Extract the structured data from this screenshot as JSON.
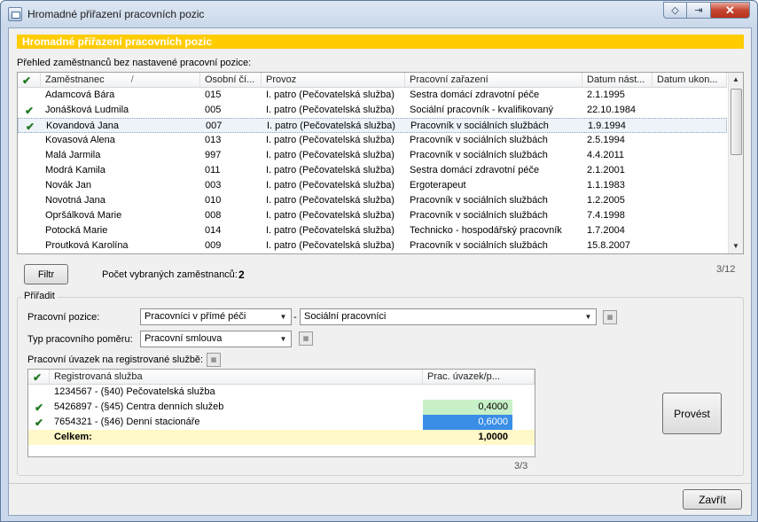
{
  "window": {
    "title": "Hromadné přiřazení pracovních pozic",
    "caption_buttons": [
      "restore-icon",
      "help-icon",
      "close-icon"
    ]
  },
  "header_band": "Hromadné přiřazení pracovních pozic",
  "overview_label": "Přehled zaměstnanců bez nastavené pracovní pozice:",
  "employees_grid": {
    "columns": [
      "",
      "Zaměstnanec",
      "Osobní čí...",
      "Provoz",
      "Pracovní zařazení",
      "Datum nást...",
      "Datum ukon..."
    ],
    "sort_indicator": "/",
    "rows": [
      {
        "checked": false,
        "name": "Adamcová Bára",
        "number": "015",
        "provoz": "I. patro (Pečovatelská služba)",
        "zarazeni": "Sestra domácí zdravotní péče",
        "nastup": "2.1.1995",
        "ukonceni": ""
      },
      {
        "checked": true,
        "name": "Jonášková Ludmila",
        "number": "005",
        "provoz": "I. patro (Pečovatelská služba)",
        "zarazeni": "Sociální pracovník - kvalifikovaný",
        "nastup": "22.10.1984",
        "ukonceni": ""
      },
      {
        "checked": true,
        "name": "Kovandová Jana",
        "number": "007",
        "provoz": "I. patro (Pečovatelská služba)",
        "zarazeni": "Pracovník v sociálních službách",
        "nastup": "1.9.1994",
        "ukonceni": "",
        "selected": true
      },
      {
        "checked": false,
        "name": "Kovasová Alena",
        "number": "013",
        "provoz": "I. patro (Pečovatelská služba)",
        "zarazeni": "Pracovník v sociálních službách",
        "nastup": "2.5.1994",
        "ukonceni": ""
      },
      {
        "checked": false,
        "name": "Malá Jarmila",
        "number": "997",
        "provoz": "I. patro (Pečovatelská služba)",
        "zarazeni": "Pracovník v sociálních službách",
        "nastup": "4.4.2011",
        "ukonceni": ""
      },
      {
        "checked": false,
        "name": "Modrá Kamila",
        "number": "011",
        "provoz": "I. patro (Pečovatelská služba)",
        "zarazeni": "Sestra domácí zdravotní péče",
        "nastup": "2.1.2001",
        "ukonceni": ""
      },
      {
        "checked": false,
        "name": "Novák Jan",
        "number": "003",
        "provoz": "I. patro (Pečovatelská služba)",
        "zarazeni": "Ergoterapeut",
        "nastup": "1.1.1983",
        "ukonceni": ""
      },
      {
        "checked": false,
        "name": "Novotná Jana",
        "number": "010",
        "provoz": "I. patro (Pečovatelská služba)",
        "zarazeni": "Pracovník v sociálních službách",
        "nastup": "1.2.2005",
        "ukonceni": ""
      },
      {
        "checked": false,
        "name": "Opršálková Marie",
        "number": "008",
        "provoz": "I. patro (Pečovatelská služba)",
        "zarazeni": "Pracovník v sociálních službách",
        "nastup": "7.4.1998",
        "ukonceni": ""
      },
      {
        "checked": false,
        "name": "Potocká Marie",
        "number": "014",
        "provoz": "I. patro (Pečovatelská služba)",
        "zarazeni": "Technicko - hospodářský pracovník",
        "nastup": "1.7.2004",
        "ukonceni": ""
      },
      {
        "checked": false,
        "name": "Proutková Karolína",
        "number": "009",
        "provoz": "I. patro (Pečovatelská služba)",
        "zarazeni": "Pracovník v sociálních službách",
        "nastup": "15.8.2007",
        "ukonceni": ""
      }
    ],
    "pager": "3/12"
  },
  "filter_button": "Filtr",
  "selected_count_label": "Počet vybraných zaměstnanců:",
  "selected_count_value": "2",
  "assign_group": {
    "title": "Přiřadit",
    "position_label": "Pracovní pozice:",
    "position_combo1": "Pracovníci v přímé péči",
    "position_separator": "-",
    "position_combo2": "Sociální pracovníci",
    "employment_label": "Typ pracovního poměru:",
    "employment_combo": "Pracovní smlouva",
    "workload_label": "Pracovní úvazek na registrované službě:",
    "services_grid": {
      "columns": [
        "",
        "Registrovaná služba",
        "Prac. úvazek/p..."
      ],
      "rows": [
        {
          "checked": false,
          "service": "1234567 - (§40) Pečovatelská služba",
          "value": ""
        },
        {
          "checked": true,
          "service": "5426897 - (§45) Centra denních služeb",
          "value": "0,4000"
        },
        {
          "checked": true,
          "service": "7654321 - (§46) Denní stacionáře",
          "value": "0,6000"
        }
      ],
      "total_label": "Celkem:",
      "total_value": "1,0000",
      "pager": "3/3"
    },
    "apply_button": "Provést"
  },
  "close_button": "Zavřít",
  "colors": {
    "header_band": "#ffcc00",
    "row_highlight_green": "#c8f0c8",
    "row_highlight_blue": "#3a8ee6",
    "total_row": "#fff8c8",
    "check": "#1f7a1f"
  }
}
